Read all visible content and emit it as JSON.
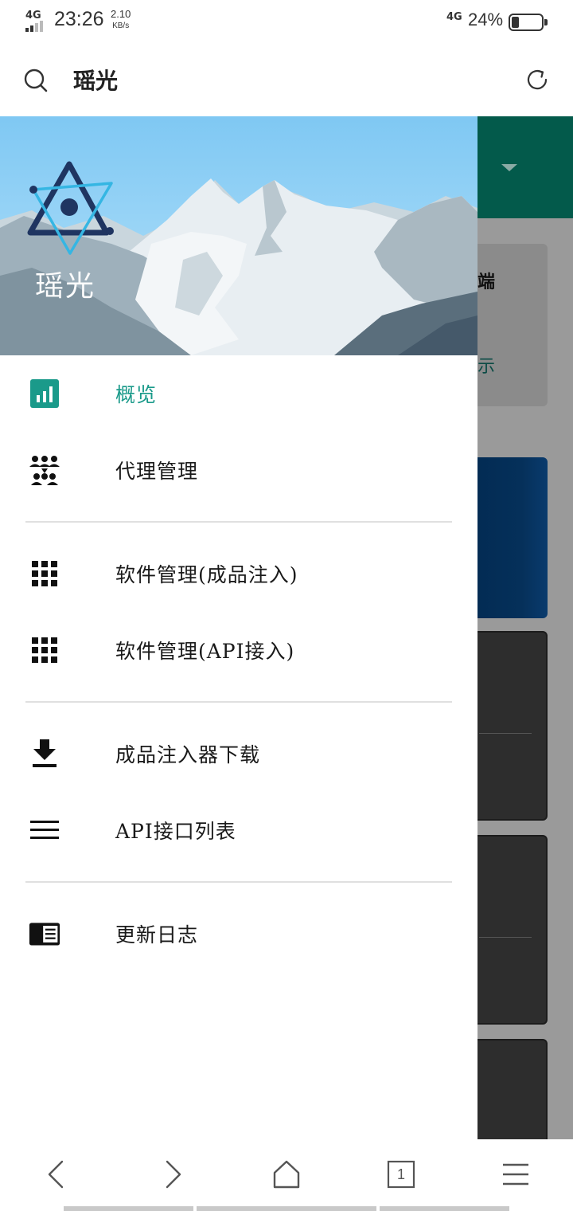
{
  "status_bar": {
    "network_left": "4G",
    "time": "23:26",
    "speed_value": "2.10",
    "speed_unit": "KB/s",
    "network_right": "4G",
    "battery_percent": "24%",
    "battery_level": 0.24
  },
  "top_bar": {
    "title": "瑶光",
    "search_icon": "search-icon",
    "refresh_icon": "refresh-icon"
  },
  "drawer": {
    "brand_name": "瑶光",
    "logo_icon": "triangle-eye-logo",
    "items": [
      {
        "label": "概览",
        "icon": "bar-chart-icon",
        "active": true
      },
      {
        "label": "代理管理",
        "icon": "group-icon",
        "active": false
      },
      {
        "label": "软件管理(成品注入)",
        "icon": "grid-icon",
        "active": false
      },
      {
        "label": "软件管理(API接入)",
        "icon": "grid-icon",
        "active": false
      },
      {
        "label": "成品注入器下载",
        "icon": "download-icon",
        "active": false
      },
      {
        "label": "API接口列表",
        "icon": "list-icon",
        "active": false
      },
      {
        "label": "更新日志",
        "icon": "changelog-icon",
        "active": false
      }
    ]
  },
  "background_page": {
    "card_title_partial": "端",
    "card_text_partial": "示"
  },
  "bottom_nav": {
    "tab_count": "1",
    "buttons": [
      "back-icon",
      "forward-icon",
      "home-icon",
      "tabs-icon",
      "menu-icon"
    ]
  },
  "colors": {
    "accent": "#1a9a8a",
    "header_green": "#035a4b",
    "sky": "#86cdf5"
  }
}
